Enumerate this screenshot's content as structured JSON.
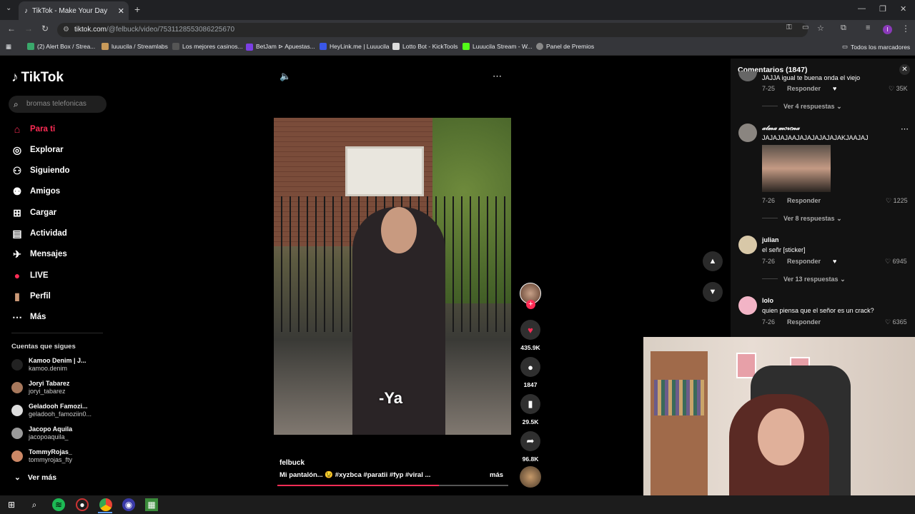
{
  "browser": {
    "tab_title": "TikTok - Make Your Day",
    "url_domain": "tiktok.com",
    "url_path": "/@felbuck/video/7531128553086225670",
    "bookmarks": [
      "(2) Alert Box / Strea...",
      "luuucila / Streamlabs",
      "Los mejores casinos...",
      "BetJam ⊳ Apuestas...",
      "HeyLink.me | Luuucila",
      "Lotto Bot - KickTools",
      "Luuucila Stream - W...",
      "Panel de Premios"
    ],
    "all_bookmarks": "Todos los marcadores"
  },
  "tiktok": {
    "logo_text": "TikTok",
    "search_placeholder": "bromas telefonicas",
    "nav": [
      "Para ti",
      "Explorar",
      "Siguiendo",
      "Amigos",
      "Cargar",
      "Actividad",
      "Mensajes",
      "LIVE",
      "Perfil",
      "Más"
    ],
    "following_title": "Cuentas que sigues",
    "accounts": [
      {
        "name": "Kamoo Denim | J...",
        "handle": "kamoo.denim"
      },
      {
        "name": "Joryi Tabarez",
        "handle": "joryi_tabarez"
      },
      {
        "name": "Geladooh Famozi...",
        "handle": "geladooh_famoziin0..."
      },
      {
        "name": "Jacopo Aquila",
        "handle": "jacopoaquila_"
      },
      {
        "name": "TommyRojas_",
        "handle": "tommyrojas_fty"
      }
    ],
    "see_more": "Ver más"
  },
  "video": {
    "subtitle": "-Ya",
    "author": "felbuck",
    "caption": "Mi pantalón... 😉 #xyzbca #paratii #fyp #viral ...",
    "more": "más",
    "progress": 0.7,
    "likes": "435.9K",
    "comments": "1847",
    "saves": "29.5K",
    "shares": "96.8K"
  },
  "comments_panel": {
    "title": "Comentarios (1847)",
    "comments": [
      {
        "user": "",
        "text": "JAJJA igual te buena onda el viejo",
        "date": "7-25",
        "reply": "Responder",
        "likes": "35K",
        "replies": "Ver 4 respuestas"
      },
      {
        "user": "𝒶𝓁𝓂𝒶 𝓂𝑜𝓇𝑒𝓃𝒶",
        "text": "JAJAJAJAAJAJAJAJAJAJAKJAAJAJ",
        "date": "7-26",
        "reply": "Responder",
        "likes": "1225",
        "replies": "Ver 8 respuestas"
      },
      {
        "user": "julian",
        "text": "el señr [sticker]",
        "date": "7-26",
        "reply": "Responder",
        "likes": "6945",
        "replies": "Ver 13 respuestas"
      },
      {
        "user": "lolo",
        "text": "quien piensa que el señor es un crack?",
        "date": "7-26",
        "reply": "Responder",
        "likes": "6365",
        "replies": ""
      }
    ]
  },
  "colors": {
    "accent": "#fe2c55"
  }
}
